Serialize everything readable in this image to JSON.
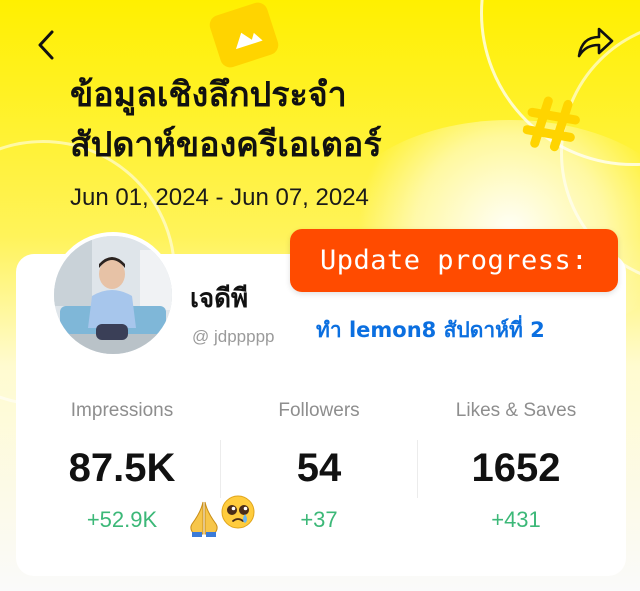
{
  "header": {
    "title_line1": "ข้อมูลเชิงลึกประจำ",
    "title_line2": "สัปดาห์ของครีเอเตอร์",
    "date_range": "Jun 01, 2024 - Jun 07, 2024",
    "back_icon": "back-chevron-icon",
    "share_icon": "share-arrow-icon"
  },
  "profile": {
    "name": "เจดีพี",
    "handle": "@ jdppppp",
    "avatar_icon": "avatar-photo"
  },
  "update": {
    "badge_text": "Update progress:",
    "subtitle": "ทำ lemon8 สัปดาห์ที่ 2",
    "badge_color": "#ff4b00",
    "subtitle_color": "#0b6fe0"
  },
  "stats": [
    {
      "label": "Impressions",
      "value": "87.5K",
      "delta": "+52.9K"
    },
    {
      "label": "Followers",
      "value": "54",
      "delta": "+37"
    },
    {
      "label": "Likes & Saves",
      "value": "1652",
      "delta": "+431"
    }
  ],
  "colors": {
    "background": "#fff200",
    "positive": "#3cb878",
    "label": "#8e8e8e"
  },
  "emojis": [
    "folded-hands-emoji",
    "pleading-face-emoji"
  ]
}
